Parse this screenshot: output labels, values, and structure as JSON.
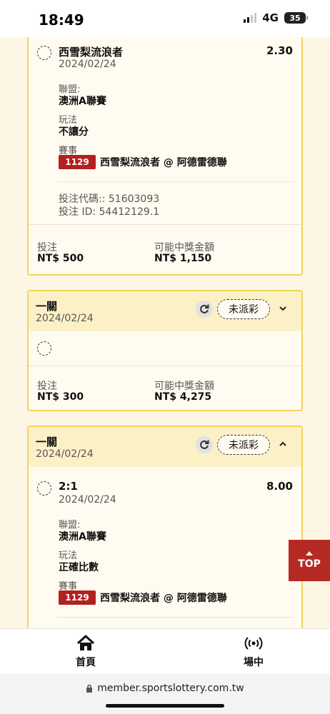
{
  "status_bar": {
    "time": "18:49",
    "network": "4G",
    "battery": "35"
  },
  "card_a": {
    "selection": {
      "name": "西雪梨流浪者",
      "odds": "2.30",
      "date": "2024/02/24",
      "league_label": "聯盟:",
      "league": "澳洲A聯賽",
      "market_label": "玩法",
      "market": "不讓分",
      "event_label": "賽事",
      "event_code": "1129",
      "event_name": "西雪梨流浪者 @ 阿德雷德聯"
    },
    "bet_code": "投注代碼:: 51603093",
    "bet_id": "投注 ID: 54412129.1",
    "stake_label": "投注",
    "stake": "NT$ 500",
    "payout_label": "可能中獎金額",
    "payout": "NT$ 1,150"
  },
  "card_b": {
    "title": "一關",
    "date": "2024/02/24",
    "status": "未派彩",
    "stake_label": "投注",
    "stake": "NT$ 300",
    "payout_label": "可能中獎金額",
    "payout": "NT$ 4,275"
  },
  "card_c": {
    "title": "一關",
    "date": "2024/02/24",
    "status": "未派彩",
    "selection": {
      "name": "2:1",
      "odds": "8.00",
      "date": "2024/02/24",
      "league_label": "聯盟:",
      "league": "澳洲A聯賽",
      "market_label": "玩法",
      "market": "正確比數",
      "event_label": "賽事",
      "event_code": "1129",
      "event_name": "西雪梨流浪者 @ 阿德雷德聯"
    }
  },
  "top_button": "TOP",
  "bottom_nav": {
    "home": "首頁",
    "live": "場中"
  },
  "browser": {
    "url": "member.sportslottery.com.tw"
  },
  "icons": {
    "home": "home-icon",
    "live": "broadcast-icon",
    "refresh": "refresh-icon",
    "lock": "lock-icon"
  },
  "colors": {
    "accent_border": "#f3d35e",
    "header_bg": "#fcf0c6",
    "event_badge": "#b32020",
    "top_button": "#b62a24"
  }
}
